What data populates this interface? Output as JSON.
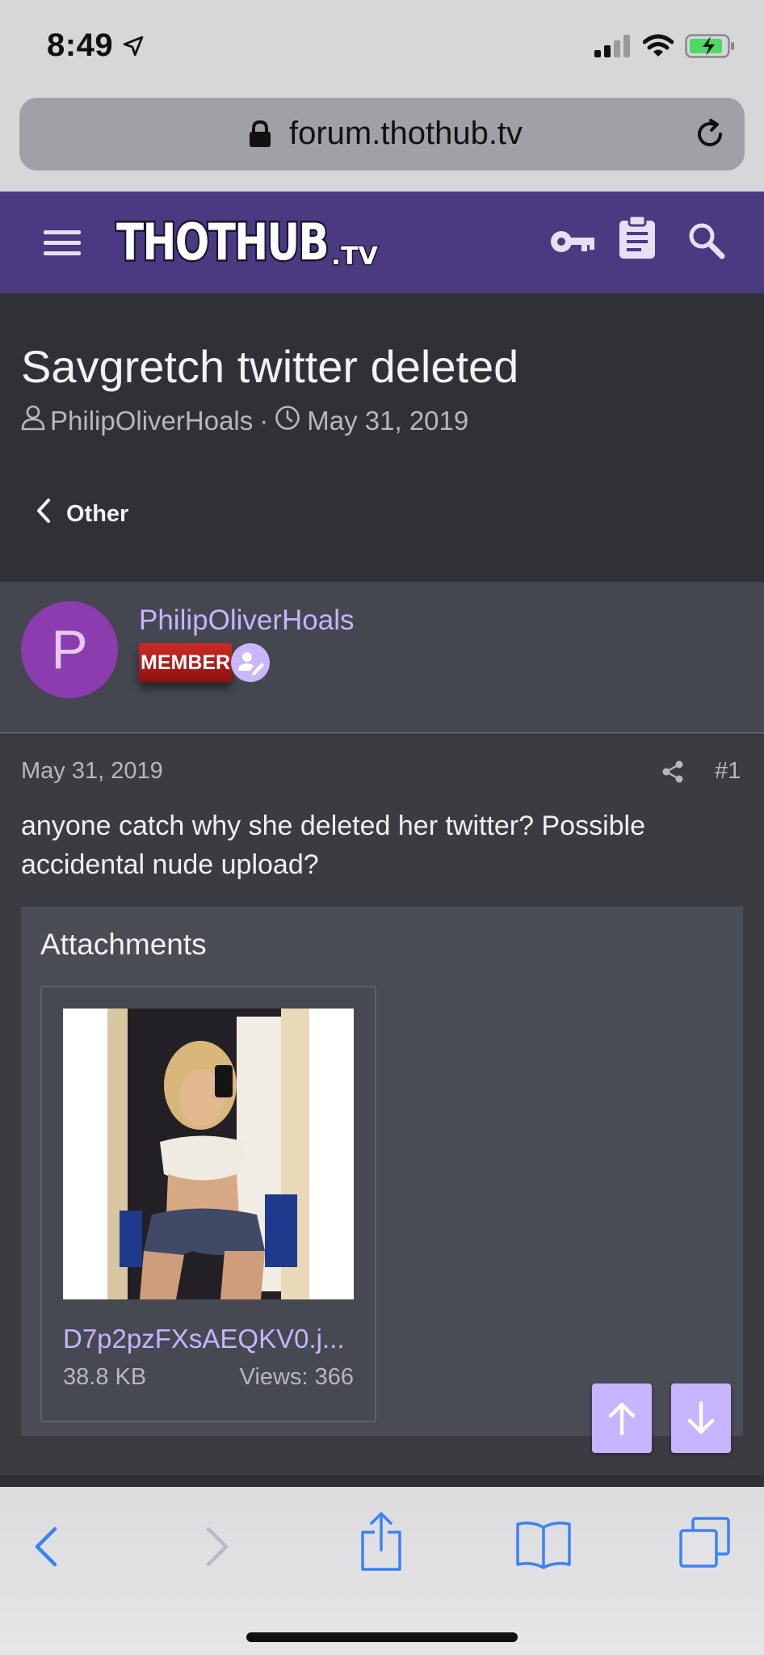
{
  "status_bar": {
    "time": "8:49"
  },
  "browser": {
    "url": "forum.thothub.tv"
  },
  "site": {
    "logo_main": "THOTHUB",
    "logo_suffix": ".TV"
  },
  "thread": {
    "title": "Savgretch twitter deleted",
    "author": "PhilipOliverHoals",
    "separator": "·",
    "date": "May 31, 2019",
    "breadcrumb": "Other"
  },
  "post": {
    "avatar_letter": "P",
    "username": "PhilipOliverHoals",
    "role_badge": "MEMBER",
    "date": "May 31, 2019",
    "number": "#1",
    "text": "anyone catch why she deleted her twitter? Possible accidental nude upload?",
    "attachments_title": "Attachments",
    "attachment": {
      "filename": "D7p2pzFXsAEQKV0.j...",
      "size": "38.8 KB",
      "views": "Views: 366"
    }
  },
  "colors": {
    "header_bg": "#4a3a82",
    "accent": "#c7b3ff",
    "badge_red": "#c4231e",
    "page_bg": "#2f3136"
  },
  "icons": {
    "status": [
      "location-arrow-icon",
      "signal-icon",
      "wifi-icon",
      "battery-charging-icon"
    ],
    "header": [
      "menu-icon",
      "key-icon",
      "clipboard-icon",
      "search-icon"
    ],
    "toolbar": [
      "back-icon",
      "forward-icon",
      "share-icon",
      "bookmarks-icon",
      "tabs-icon"
    ]
  }
}
